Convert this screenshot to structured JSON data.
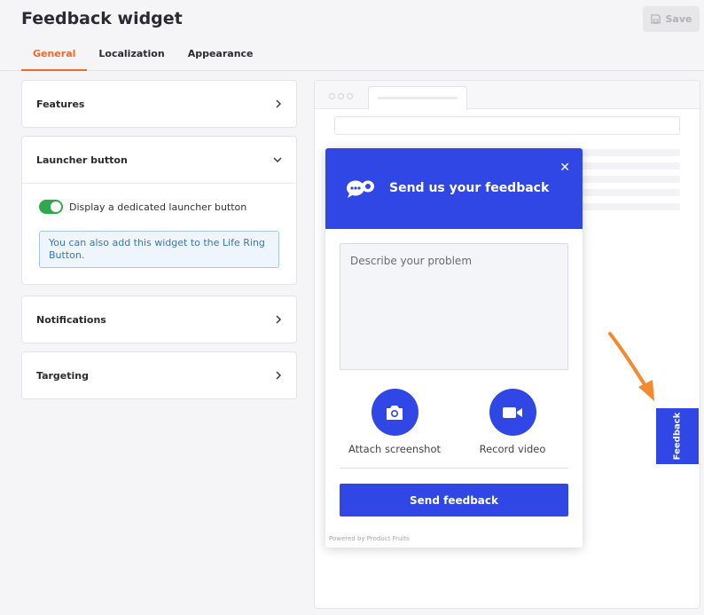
{
  "header": {
    "title": "Feedback widget",
    "save_label": "Save",
    "tabs": [
      {
        "label": "General",
        "active": true
      },
      {
        "label": "Localization",
        "active": false
      },
      {
        "label": "Appearance",
        "active": false
      }
    ]
  },
  "settings": {
    "features": {
      "label": "Features"
    },
    "launcher": {
      "label": "Launcher button",
      "toggle_label": "Display a dedicated launcher button",
      "toggle_on": true,
      "info_text": "You can also add this widget to the Life Ring Button."
    },
    "notifications": {
      "label": "Notifications"
    },
    "targeting": {
      "label": "Targeting"
    }
  },
  "widget": {
    "title": "Send us your feedback",
    "placeholder": "Describe your problem",
    "attach_label": "Attach screenshot",
    "record_label": "Record video",
    "send_label": "Send feedback",
    "powered_by": "Powered by Product Fruits"
  },
  "launcher_button": {
    "label": "Feedback"
  },
  "colors": {
    "accent": "#f06a2b",
    "widget_primary": "#3047e6",
    "toggle_on": "#2fa84f"
  },
  "icons": [
    "save-icon",
    "chevron-right-icon",
    "chevron-down-icon",
    "chat-bubbles-icon",
    "close-icon",
    "camera-icon",
    "video-camera-icon",
    "arrow-icon"
  ]
}
